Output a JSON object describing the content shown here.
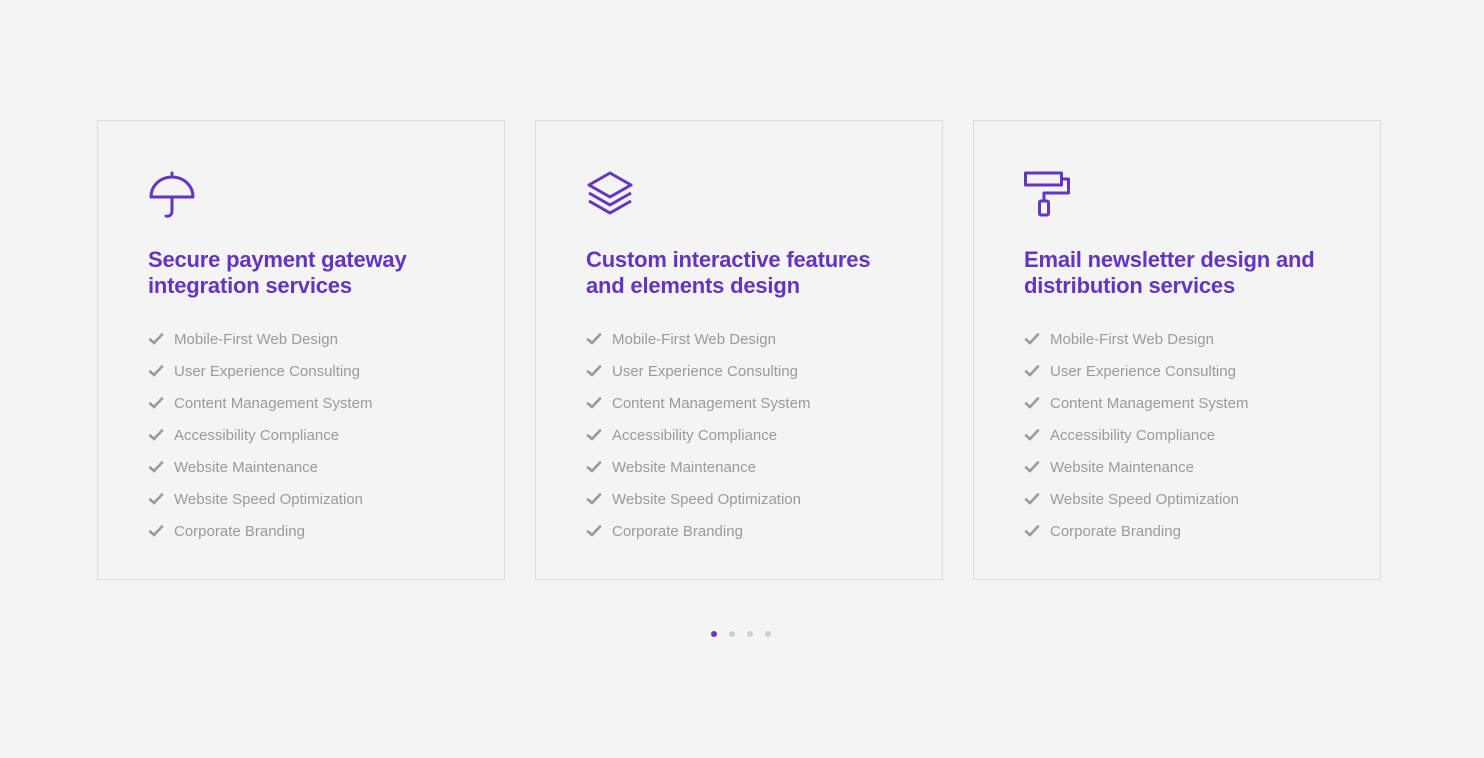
{
  "colors": {
    "accent": "#6434c2",
    "text_muted": "#9a9a9a",
    "border": "#dcdcdc",
    "background": "#f4f4f4",
    "dot_inactive": "#cfcfcf"
  },
  "cards": [
    {
      "icon": "umbrella-icon",
      "title": "Secure payment gateway integration services",
      "features": [
        "Mobile-First Web Design",
        "User Experience Consulting",
        "Content Management System",
        "Accessibility Compliance",
        "Website Maintenance",
        "Website Speed Optimization",
        "Corporate Branding"
      ]
    },
    {
      "icon": "layers-icon",
      "title": "Custom interactive features and elements design",
      "features": [
        "Mobile-First Web Design",
        "User Experience Consulting",
        "Content Management System",
        "Accessibility Compliance",
        "Website Maintenance",
        "Website Speed Optimization",
        "Corporate Branding"
      ]
    },
    {
      "icon": "paint-roller-icon",
      "title": "Email newsletter design and distribution services",
      "features": [
        "Mobile-First Web Design",
        "User Experience Consulting",
        "Content Management System",
        "Accessibility Compliance",
        "Website Maintenance",
        "Website Speed Optimization",
        "Corporate Branding"
      ]
    }
  ],
  "pagination": {
    "active_index": 0
  }
}
